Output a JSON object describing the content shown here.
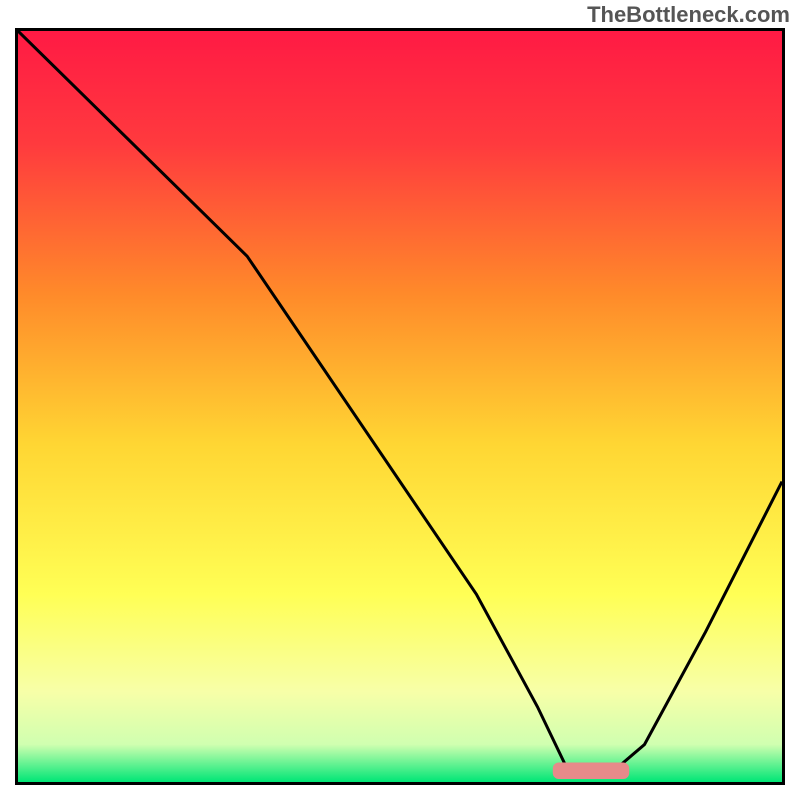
{
  "watermark": "TheBottleneck.com",
  "chart_data": {
    "type": "line",
    "title": "",
    "xlabel": "",
    "ylabel": "",
    "xlim": [
      0,
      100
    ],
    "ylim": [
      0,
      100
    ],
    "background": {
      "type": "vertical-gradient",
      "stops": [
        {
          "offset": 0.0,
          "color": "#ff1a44"
        },
        {
          "offset": 0.15,
          "color": "#ff3a3e"
        },
        {
          "offset": 0.35,
          "color": "#ff8a2a"
        },
        {
          "offset": 0.55,
          "color": "#ffd633"
        },
        {
          "offset": 0.75,
          "color": "#ffff55"
        },
        {
          "offset": 0.88,
          "color": "#f7ffa8"
        },
        {
          "offset": 0.95,
          "color": "#d0ffb0"
        },
        {
          "offset": 1.0,
          "color": "#00e676"
        }
      ]
    },
    "series": [
      {
        "name": "bottleneck-curve",
        "color": "#000000",
        "x": [
          0,
          10,
          20,
          30,
          40,
          50,
          60,
          68,
          72,
          78,
          82,
          90,
          100
        ],
        "y": [
          100,
          90,
          80,
          70,
          55,
          40,
          25,
          10,
          1.5,
          1.5,
          5,
          20,
          40
        ]
      }
    ],
    "marker": {
      "name": "optimal-segment",
      "shape": "rounded-bar",
      "color": "#e78a8a",
      "x_start": 70,
      "x_end": 80,
      "y": 1.5,
      "height": 2.2
    }
  }
}
